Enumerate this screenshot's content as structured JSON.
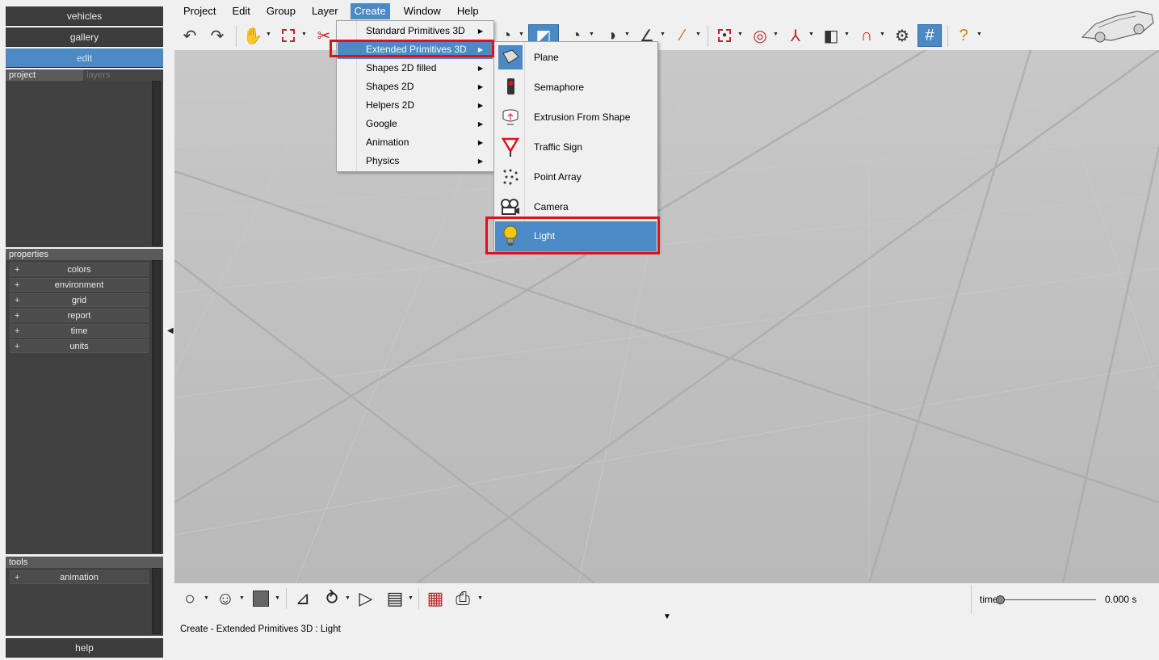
{
  "left_nav": {
    "vehicles": "vehicles",
    "gallery": "gallery",
    "edit": "edit"
  },
  "project_panel": {
    "tab_project": "project",
    "tab_layers": "layers"
  },
  "properties_panel": {
    "title": "properties",
    "items": [
      {
        "plus": "+",
        "label": "colors"
      },
      {
        "plus": "+",
        "label": "environment"
      },
      {
        "plus": "+",
        "label": "grid"
      },
      {
        "plus": "+",
        "label": "report"
      },
      {
        "plus": "+",
        "label": "time"
      },
      {
        "plus": "+",
        "label": "units"
      }
    ]
  },
  "tools_panel": {
    "title": "tools",
    "items": [
      {
        "plus": "+",
        "label": "animation"
      }
    ]
  },
  "help": "help",
  "menubar": [
    "Project",
    "Edit",
    "Group",
    "Layer",
    "Create",
    "Window",
    "Help"
  ],
  "create_menu": {
    "items": [
      "Standard Primitives 3D",
      "Extended Primitives 3D",
      "Shapes 2D filled",
      "Shapes 2D",
      "Helpers 2D",
      "Google",
      "Animation",
      "Physics"
    ],
    "highlighted": "Extended Primitives 3D"
  },
  "extended_submenu": {
    "items": [
      {
        "label": "Plane",
        "icon": "plane-icon"
      },
      {
        "label": "Semaphore",
        "icon": "semaphore-icon"
      },
      {
        "label": "Extrusion From Shape",
        "icon": "extrusion-icon"
      },
      {
        "label": "Traffic Sign",
        "icon": "traffic-sign-icon"
      },
      {
        "label": "Point Array",
        "icon": "point-array-icon"
      },
      {
        "label": "Camera",
        "icon": "camera-icon"
      },
      {
        "label": "Light",
        "icon": "light-bulb-icon"
      }
    ],
    "highlighted": "Light"
  },
  "time": {
    "label": "time",
    "value": "0.000 s"
  },
  "status_text": "Create - Extended Primitives 3D : Light",
  "colors": {
    "accent": "#4b8ac4",
    "highlight_box": "#e0101c",
    "panel_dark": "#414141",
    "viewport": "#bdbdbd"
  }
}
